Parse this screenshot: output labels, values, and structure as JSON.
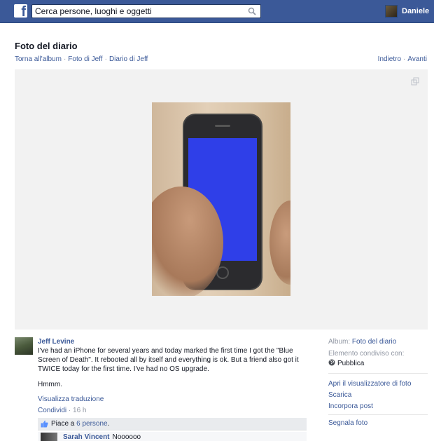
{
  "topbar": {
    "logo_letter": "f",
    "search_placeholder": "Cerca persone, luoghi e oggetti",
    "user_name": "Daniele"
  },
  "header": {
    "title": "Foto del diario",
    "breadcrumbs": [
      "Torna all'album",
      "Foto di Jeff",
      "Diario di Jeff"
    ],
    "nav_prev": "Indietro",
    "nav_next": "Avanti"
  },
  "post": {
    "author": "Jeff Levine",
    "text": "I've had an iPhone for several years and today marked the first time I got the \"Blue Screen of Death\". It rebooted all by itself and everything is ok. But a friend also got it TWICE today for the first time. I've had no OS upgrade.",
    "text2": "Hmmm.",
    "translate": "Visualizza traduzione",
    "share": "Condividi",
    "time": "16 h",
    "likes_prefix": "Piace a",
    "likes_count": "6 persone",
    "likes_suffix": ".",
    "comment": {
      "name": "Sarah Vincent",
      "text": "Noooooo"
    }
  },
  "sidebar": {
    "album_label": "Album:",
    "album_value": "Foto del diario",
    "shared_label": "Elemento condiviso con:",
    "shared_value": "Pubblica",
    "actions": [
      "Apri il visualizzatore di foto",
      "Scarica",
      "Incorpora post"
    ],
    "report": "Segnala foto"
  },
  "colors": {
    "brand": "#3b5998",
    "screen_blue": "#2f3fe8"
  },
  "icons": [
    "search-icon",
    "expand-icon",
    "like-icon",
    "globe-icon"
  ]
}
